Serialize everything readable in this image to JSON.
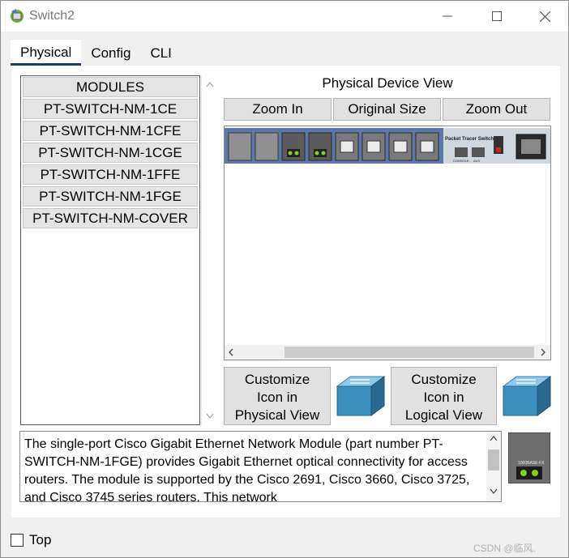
{
  "window": {
    "title": "Switch2"
  },
  "tabs": [
    {
      "label": "Physical"
    },
    {
      "label": "Config"
    },
    {
      "label": "CLI"
    }
  ],
  "modules": {
    "items": [
      {
        "label": "MODULES"
      },
      {
        "label": "PT-SWITCH-NM-1CE"
      },
      {
        "label": "PT-SWITCH-NM-1CFE"
      },
      {
        "label": "PT-SWITCH-NM-1CGE"
      },
      {
        "label": "PT-SWITCH-NM-1FFE"
      },
      {
        "label": "PT-SWITCH-NM-1FGE"
      },
      {
        "label": "PT-SWITCH-NM-COVER"
      }
    ]
  },
  "device_view": {
    "title": "Physical Device View",
    "zoom_in": "Zoom In",
    "original_size": "Original Size",
    "zoom_out": "Zoom Out",
    "device_label": "Packet Tracer Switch",
    "console_label": "CONSOLE",
    "aux_label": "AUX"
  },
  "customize": {
    "physical": {
      "line1": "Customize",
      "line2": "Icon in",
      "line3": "Physical View"
    },
    "logical": {
      "line1": "Customize",
      "line2": "Icon in",
      "line3": "Logical View"
    }
  },
  "description": {
    "text": "The single-port Cisco Gigabit Ethernet Network Module (part number PT-SWITCH-NM-1FGE) provides Gigabit Ethernet optical connectivity for access routers. The module is supported by the Cisco 2691, Cisco 3660, Cisco 3725, and Cisco 3745 series routers. This network"
  },
  "module_image": {
    "label": "1000BASE-FX"
  },
  "footer": {
    "top_label": "Top",
    "watermark": "CSDN @临风."
  }
}
